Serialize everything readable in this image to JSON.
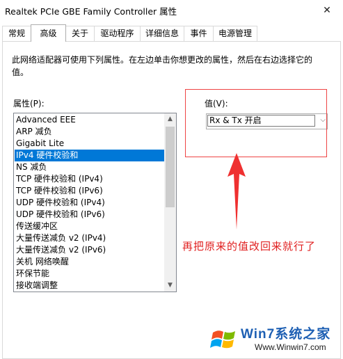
{
  "window": {
    "title": "Realtek PCIe GBE Family Controller 属性",
    "close_glyph": "✕"
  },
  "tabs": [
    {
      "label": "常规"
    },
    {
      "label": "高级",
      "active": true
    },
    {
      "label": "关于"
    },
    {
      "label": "驱动程序"
    },
    {
      "label": "详细信息"
    },
    {
      "label": "事件"
    },
    {
      "label": "电源管理"
    }
  ],
  "description": "此网络适配器可使用下列属性。在左边单击你想更改的属性，然后在右边选择它的值。",
  "property_label": "属性(P):",
  "properties": [
    {
      "label": "Advanced EEE"
    },
    {
      "label": "ARP 减负"
    },
    {
      "label": "Gigabit Lite"
    },
    {
      "label": "IPv4 硬件校验和",
      "selected": true
    },
    {
      "label": "NS 减负"
    },
    {
      "label": "TCP 硬件校验和 (IPv4)"
    },
    {
      "label": "TCP 硬件校验和 (IPv6)"
    },
    {
      "label": "UDP 硬件校验和 (IPv4)"
    },
    {
      "label": "UDP 硬件校验和 (IPv6)"
    },
    {
      "label": "传送缓冲区"
    },
    {
      "label": "大量传送减负 v2 (IPv4)"
    },
    {
      "label": "大量传送减负 v2 (IPv6)"
    },
    {
      "label": "关机 网络唤醒"
    },
    {
      "label": "环保节能"
    },
    {
      "label": "接收端调整"
    }
  ],
  "value_label": "值(V):",
  "value_selected": "Rx & Tx 开启",
  "annotation": "再把原来的值改回来就行了",
  "watermark": {
    "brand": "Win7系统之家",
    "url": "Www.Winwin7.com"
  },
  "colors": {
    "selection": "#0078d7",
    "annotation": "#e02020",
    "brand": "#1d5fb3"
  }
}
